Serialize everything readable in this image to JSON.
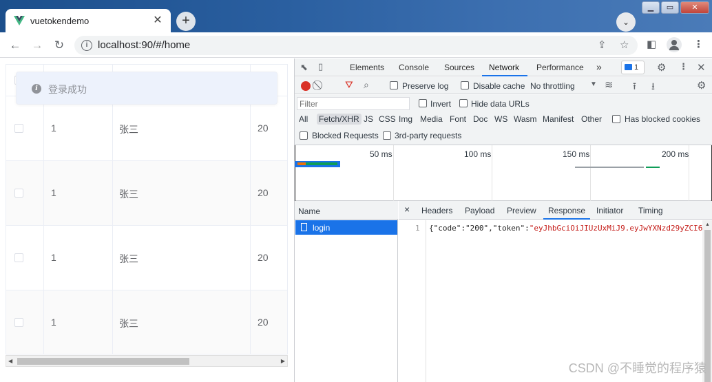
{
  "browser": {
    "tab_title": "vuetokendemo",
    "url": "localhost:90/#/home",
    "newtab_label": "+",
    "close_tab_label": "✕",
    "dropdown_label": "⌄",
    "window_buttons": {
      "minimize": "▁",
      "maximize": "▭",
      "close": "✕"
    }
  },
  "page": {
    "toast_message": "登录成功",
    "rows": [
      {
        "id": "1",
        "name": "张三",
        "age": "20"
      },
      {
        "id": "1",
        "name": "张三",
        "age": "20"
      },
      {
        "id": "1",
        "name": "张三",
        "age": "20"
      },
      {
        "id": "1",
        "name": "张三",
        "age": "20"
      }
    ]
  },
  "devtools": {
    "tabs": [
      "Elements",
      "Console",
      "Sources",
      "Network",
      "Performance"
    ],
    "active_tab": "Network",
    "more_tabs": "»",
    "issues_count": "1",
    "toolbar": {
      "preserve_log": "Preserve log",
      "disable_cache": "Disable cache",
      "throttling": "No throttling"
    },
    "filter": {
      "placeholder": "Filter",
      "invert": "Invert",
      "hide_data_urls": "Hide data URLs",
      "types": [
        "All",
        "Fetch/XHR",
        "JS",
        "CSS",
        "Img",
        "Media",
        "Font",
        "Doc",
        "WS",
        "Wasm",
        "Manifest",
        "Other"
      ],
      "selected_type": "Fetch/XHR",
      "has_blocked_cookies": "Has blocked cookies",
      "blocked_requests": "Blocked Requests",
      "third_party": "3rd-party requests"
    },
    "overview_ticks": [
      "50 ms",
      "100 ms",
      "150 ms",
      "200 ms"
    ],
    "requests": {
      "column_name": "Name",
      "items": [
        "login"
      ]
    },
    "detail": {
      "close": "×",
      "tabs": [
        "Headers",
        "Payload",
        "Preview",
        "Response",
        "Initiator",
        "Timing"
      ],
      "active_tab": "Response",
      "line_number": "1",
      "response_prefix": "{\"code\":\"200\",\"token\":",
      "response_token": "\"eyJhbGciOiJIUzUxMiJ9.eyJwYXNzd29yZCI6"
    }
  },
  "watermark": "CSDN @不睡觉的程序猿",
  "colors": {
    "accent": "#1a73e8",
    "record": "#d93025",
    "vue_green": "#41b883",
    "toast_bg": "#edf2fc"
  }
}
